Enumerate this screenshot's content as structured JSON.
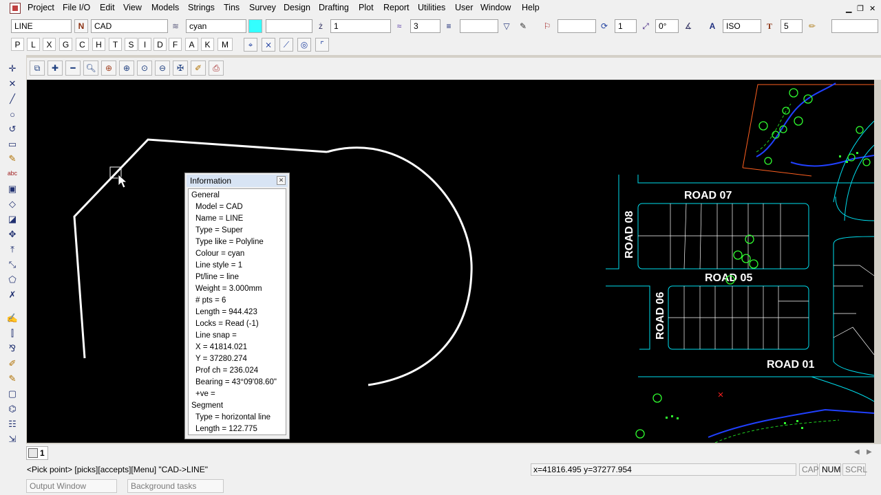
{
  "menu": [
    "Project",
    "File I/O",
    "Edit",
    "View",
    "Models",
    "Strings",
    "Tins",
    "Survey",
    "Design",
    "Drafting",
    "Plot",
    "Report",
    "Utilities",
    "User",
    "Window",
    "Help"
  ],
  "toolbar": {
    "name_value": "LINE",
    "model_value": "CAD",
    "colour_value": "cyan",
    "colour_swatch": "#33ffff",
    "line_style_value": "1",
    "weight_value": "3",
    "counter_value": "1",
    "angle_value": "0°",
    "text_style_value": "ISO",
    "text_size_value": "5"
  },
  "letter_buttons": [
    "P",
    "L",
    "X",
    "G",
    "C",
    "H",
    "T",
    "S",
    "I",
    "D",
    "F",
    "A",
    "K",
    "M"
  ],
  "info_panel": {
    "title": "Information",
    "close_glyph": "✕",
    "lines": [
      "General",
      "Model = CAD",
      "Name = LINE",
      "Type = Super",
      "Type like = Polyline",
      "Colour = cyan",
      "Line style = 1",
      "Pt/line = line",
      "Weight = 3.000mm",
      "# pts = 6",
      "Length = 944.423",
      "Locks = Read (-1)",
      "Line snap =",
      "X = 41814.021",
      "Y = 37280.274",
      "Prof ch = 236.024",
      "Bearing = 43°09'08.60\"",
      "+ve =",
      "Segment",
      "Type = horizontal line",
      "Length = 122.775"
    ]
  },
  "roads": [
    "ROAD 07",
    "ROAD 08",
    "ROAD 05",
    "ROAD 06",
    "ROAD 01"
  ],
  "tab": {
    "label": "1"
  },
  "status": {
    "prompt": "<Pick point> [picks][accepts][Menu] \"CAD->LINE\"",
    "coords": "x=41816.495 y=37277.954",
    "cap": "CAP",
    "num": "NUM",
    "scrl": "SCRL"
  },
  "bottom_tabs": [
    "Output Window",
    "Background tasks"
  ],
  "colors": {
    "canvas": "#000000",
    "cad_line": "#ffffff",
    "road_lines": "#00e0f0",
    "trees": "#30ff30",
    "boundary": "#ff6020"
  }
}
